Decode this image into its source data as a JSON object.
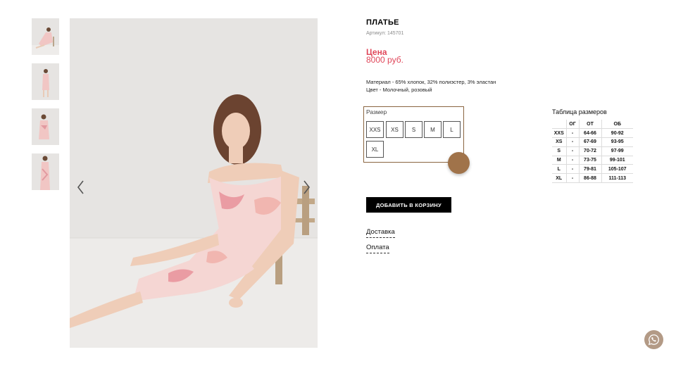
{
  "product": {
    "title": "ПЛАТЬЕ",
    "sku": "Артикул: 145701",
    "price_label": "Цена",
    "price_value": "8000 руб.",
    "material": "Материал - 65% хлопок, 32% полиэстер, 3% эластан",
    "color": "Цвет - Молочный, розовый"
  },
  "gallery": {
    "thumbnails": [
      "thumbnail-1",
      "thumbnail-2",
      "thumbnail-3",
      "thumbnail-4"
    ],
    "prev_icon": "chevron-left-icon",
    "next_icon": "chevron-right-icon"
  },
  "size_selector": {
    "label": "Размер",
    "options": [
      "XXS",
      "XS",
      "S",
      "M",
      "L",
      "XL"
    ],
    "accent_color": "#8a6540"
  },
  "cart": {
    "add_label": "ДОБАВИТЬ В КОРЗИНУ"
  },
  "links": {
    "delivery": "Доставка",
    "payment": "Оплата"
  },
  "size_table": {
    "title": "Таблица размеров",
    "headers": [
      "",
      "ОГ",
      "ОТ",
      "ОБ"
    ],
    "rows": [
      [
        "XXS",
        "-",
        "64-66",
        "90-92"
      ],
      [
        "XS",
        "-",
        "67-69",
        "93-95"
      ],
      [
        "S",
        "-",
        "70-72",
        "97-99"
      ],
      [
        "M",
        "-",
        "73-75",
        "99-101"
      ],
      [
        "L",
        "-",
        "79-81",
        "105-107"
      ],
      [
        "XL",
        "-",
        "86-88",
        "111-113"
      ]
    ]
  },
  "colors": {
    "price": "#e0475a",
    "cart_button": "#000000",
    "whatsapp": "#b39a86"
  },
  "whatsapp": {
    "icon": "whatsapp-icon"
  }
}
